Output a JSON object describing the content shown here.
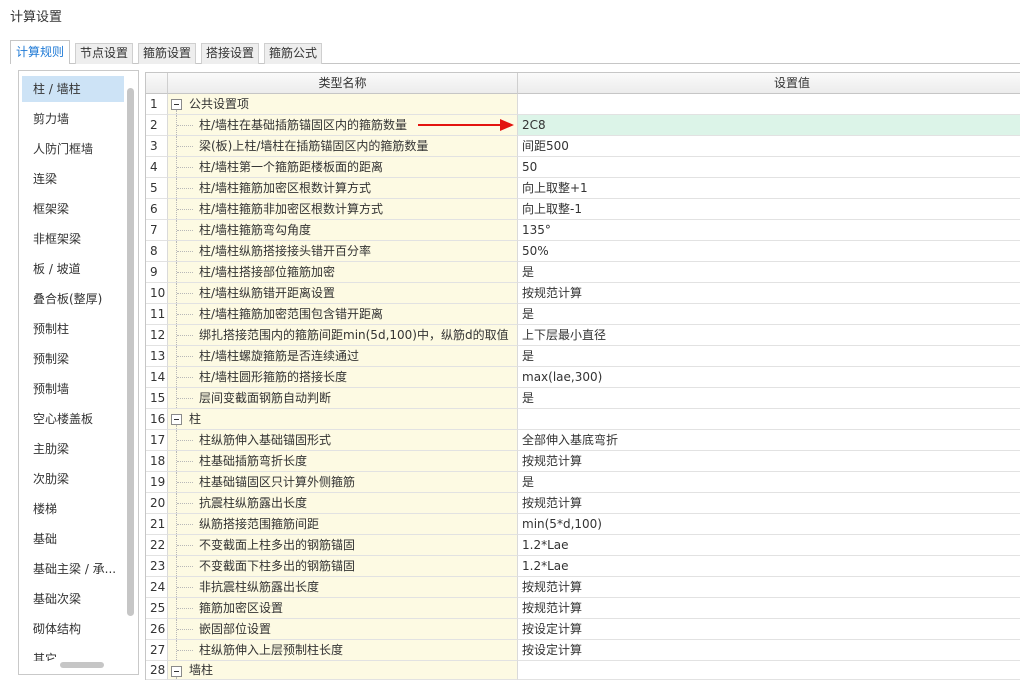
{
  "window": {
    "title": "计算设置"
  },
  "tabs": [
    {
      "label": "计算规则",
      "active": true
    },
    {
      "label": "节点设置",
      "active": false
    },
    {
      "label": "箍筋设置",
      "active": false
    },
    {
      "label": "搭接设置",
      "active": false
    },
    {
      "label": "箍筋公式",
      "active": false
    }
  ],
  "sidebar": {
    "selected_index": 0,
    "items": [
      "柱 / 墙柱",
      "剪力墙",
      "人防门框墙",
      "连梁",
      "框架梁",
      "非框架梁",
      "板 / 坡道",
      "叠合板(整厚)",
      "预制柱",
      "预制梁",
      "预制墙",
      "空心楼盖板",
      "主肋梁",
      "次肋梁",
      "楼梯",
      "基础",
      "基础主梁 / 承...",
      "基础次梁",
      "砌体结构",
      "其它"
    ]
  },
  "table": {
    "columns": {
      "name": "类型名称",
      "value": "设置值"
    },
    "selected_row": 2,
    "rows": [
      {
        "num": "1",
        "name": "公共设置项",
        "group": true,
        "expanded": true
      },
      {
        "num": "2",
        "name": "柱/墙柱在基础插筋锚固区内的箍筋数量",
        "value": "2C8"
      },
      {
        "num": "3",
        "name": "梁(板)上柱/墙柱在插筋锚固区内的箍筋数量",
        "value": "间距500"
      },
      {
        "num": "4",
        "name": "柱/墙柱第一个箍筋距楼板面的距离",
        "value": "50"
      },
      {
        "num": "5",
        "name": "柱/墙柱箍筋加密区根数计算方式",
        "value": "向上取整+1"
      },
      {
        "num": "6",
        "name": "柱/墙柱箍筋非加密区根数计算方式",
        "value": "向上取整-1"
      },
      {
        "num": "7",
        "name": "柱/墙柱箍筋弯勾角度",
        "value": "135°"
      },
      {
        "num": "8",
        "name": "柱/墙柱纵筋搭接接头错开百分率",
        "value": "50%"
      },
      {
        "num": "9",
        "name": "柱/墙柱搭接部位箍筋加密",
        "value": "是"
      },
      {
        "num": "10",
        "name": "柱/墙柱纵筋错开距离设置",
        "value": "按规范计算"
      },
      {
        "num": "11",
        "name": "柱/墙柱箍筋加密范围包含错开距离",
        "value": "是"
      },
      {
        "num": "12",
        "name": "绑扎搭接范围内的箍筋间距min(5d,100)中，纵筋d的取值",
        "value": "上下层最小直径"
      },
      {
        "num": "13",
        "name": "柱/墙柱螺旋箍筋是否连续通过",
        "value": "是"
      },
      {
        "num": "14",
        "name": "柱/墙柱圆形箍筋的搭接长度",
        "value": "max(lae,300)"
      },
      {
        "num": "15",
        "name": "层间变截面钢筋自动判断",
        "value": "是"
      },
      {
        "num": "16",
        "name": "柱",
        "group": true,
        "expanded": true
      },
      {
        "num": "17",
        "name": "柱纵筋伸入基础锚固形式",
        "value": "全部伸入基底弯折"
      },
      {
        "num": "18",
        "name": "柱基础插筋弯折长度",
        "value": "按规范计算"
      },
      {
        "num": "19",
        "name": "柱基础锚固区只计算外侧箍筋",
        "value": "是"
      },
      {
        "num": "20",
        "name": "抗震柱纵筋露出长度",
        "value": "按规范计算"
      },
      {
        "num": "21",
        "name": "纵筋搭接范围箍筋间距",
        "value": "min(5*d,100)"
      },
      {
        "num": "22",
        "name": "不变截面上柱多出的钢筋锚固",
        "value": "1.2*Lae"
      },
      {
        "num": "23",
        "name": "不变截面下柱多出的钢筋锚固",
        "value": "1.2*Lae"
      },
      {
        "num": "24",
        "name": "非抗震柱纵筋露出长度",
        "value": "按规范计算"
      },
      {
        "num": "25",
        "name": "箍筋加密区设置",
        "value": "按规范计算"
      },
      {
        "num": "26",
        "name": "嵌固部位设置",
        "value": "按设定计算"
      },
      {
        "num": "27",
        "name": "柱纵筋伸入上层预制柱长度",
        "value": "按设定计算"
      },
      {
        "num": "28",
        "name": "墙柱",
        "group": true,
        "expanded": true
      }
    ]
  },
  "annotation": {
    "icon": "red-arrow-icon",
    "target_row": 2
  },
  "colors": {
    "accent": "#1f7ad6",
    "selected_item_bg": "#cde3f6",
    "name_column_bg": "#fdfae3",
    "selected_value_bg": "#dcf4e8",
    "arrow": "#e3140f"
  }
}
